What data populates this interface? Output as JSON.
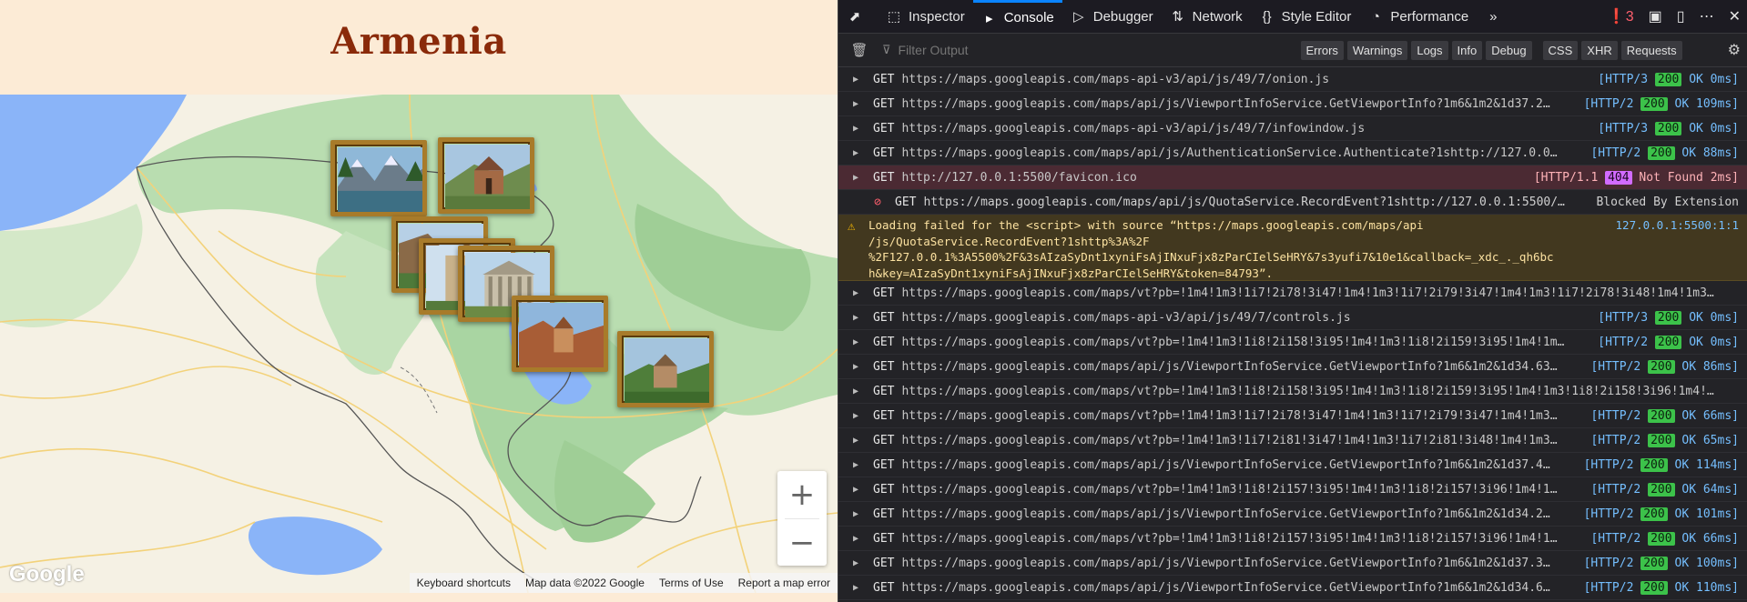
{
  "page": {
    "title": "Armenia",
    "map": {
      "zoom_in": "+",
      "zoom_out": "−",
      "logo": "Google",
      "footer": [
        "Keyboard shortcuts",
        "Map data ©2022 Google",
        "Terms of Use",
        "Report a map error"
      ]
    }
  },
  "devtools": {
    "tabs": [
      {
        "icon": "inspector-icon",
        "glyph": "⬚",
        "label": "Inspector"
      },
      {
        "icon": "console-icon",
        "glyph": "▸",
        "label": "Console",
        "active": true
      },
      {
        "icon": "debugger-icon",
        "glyph": "▷",
        "label": "Debugger"
      },
      {
        "icon": "network-icon",
        "glyph": "⇅",
        "label": "Network"
      },
      {
        "icon": "style-editor-icon",
        "glyph": "{}",
        "label": "Style Editor"
      },
      {
        "icon": "performance-icon",
        "glyph": "◔",
        "label": "Performance"
      }
    ],
    "error_count": "3",
    "filter_placeholder": "Filter Output",
    "filter_buttons": [
      "Errors",
      "Warnings",
      "Logs",
      "Info",
      "Debug",
      "CSS",
      "XHR",
      "Requests"
    ],
    "logs": [
      {
        "type": "net",
        "method": "GET",
        "url": "https://maps.googleapis.com/maps-api-v3/api/js/49/7/onion.js",
        "proto": "[HTTP/3",
        "code": "200",
        "tail": "OK 0ms]"
      },
      {
        "type": "net",
        "method": "GET",
        "url": "https://maps.googleapis.com/maps/api/js/ViewportInfoService.GetViewportInfo?1m6&1m2&1d37.2…",
        "proto": "[HTTP/2",
        "code": "200",
        "tail": "OK 109ms]"
      },
      {
        "type": "net",
        "method": "GET",
        "url": "https://maps.googleapis.com/maps-api-v3/api/js/49/7/infowindow.js",
        "proto": "[HTTP/3",
        "code": "200",
        "tail": "OK 0ms]"
      },
      {
        "type": "net",
        "method": "GET",
        "url": "https://maps.googleapis.com/maps/api/js/AuthenticationService.Authenticate?1shttp://127.0.0…",
        "proto": "[HTTP/2",
        "code": "200",
        "tail": "OK 88ms]"
      },
      {
        "type": "err",
        "method": "GET",
        "url": "http://127.0.0.1:5500/favicon.ico",
        "proto": "[HTTP/1.1",
        "code": "404",
        "tail": "Not Found 2ms]"
      },
      {
        "type": "block",
        "method": "GET",
        "url": "https://maps.googleapis.com/maps/api/js/QuotaService.RecordEvent?1shttp://127.0.0.1:5500/…",
        "proto": "",
        "code": "",
        "tail": "Blocked By Extension"
      },
      {
        "type": "warn",
        "text": "Loading failed for the <script> with source “https://maps.googleapis.com/maps/api\n/js/QuotaService.RecordEvent?1shttp%3A%2F\n%2F127.0.0.1%3A5500%2F&3sAIzaSyDnt1xyniFsAjINxuFjx8zParCIelSeHRY&7s3yufi7&10e1&callback=_xdc_._qh6bc\nh&key=AIzaSyDnt1xyniFsAjINxuFjx8zParCIelSeHRY&token=84793”.",
        "source": "127.0.0.1:5500:1:1"
      },
      {
        "type": "net",
        "method": "GET",
        "url": "https://maps.googleapis.com/maps/vt?pb=!1m4!1m3!1i7!2i78!3i47!1m4!1m3!1i7!2i79!3i47!1m4!1m3!1i7!2i78!3i48!1m4!1m3…",
        "proto": "",
        "code": "",
        "tail": ""
      },
      {
        "type": "net",
        "method": "GET",
        "url": "https://maps.googleapis.com/maps-api-v3/api/js/49/7/controls.js",
        "proto": "[HTTP/3",
        "code": "200",
        "tail": "OK 0ms]"
      },
      {
        "type": "net",
        "method": "GET",
        "url": "https://maps.googleapis.com/maps/vt?pb=!1m4!1m3!1i8!2i158!3i95!1m4!1m3!1i8!2i159!3i95!1m4!1m…",
        "proto": "[HTTP/2",
        "code": "200",
        "tail": "OK 0ms]"
      },
      {
        "type": "net",
        "method": "GET",
        "url": "https://maps.googleapis.com/maps/api/js/ViewportInfoService.GetViewportInfo?1m6&1m2&1d34.63…",
        "proto": "[HTTP/2",
        "code": "200",
        "tail": "OK 86ms]"
      },
      {
        "type": "net",
        "method": "GET",
        "url": "https://maps.googleapis.com/maps/vt?pb=!1m4!1m3!1i8!2i158!3i95!1m4!1m3!1i8!2i159!3i95!1m4!1m3!1i8!2i158!3i96!1m4!…",
        "proto": "",
        "code": "",
        "tail": ""
      },
      {
        "type": "net",
        "method": "GET",
        "url": "https://maps.googleapis.com/maps/vt?pb=!1m4!1m3!1i7!2i78!3i47!1m4!1m3!1i7!2i79!3i47!1m4!1m3…",
        "proto": "[HTTP/2",
        "code": "200",
        "tail": "OK 66ms]"
      },
      {
        "type": "net",
        "method": "GET",
        "url": "https://maps.googleapis.com/maps/vt?pb=!1m4!1m3!1i7!2i81!3i47!1m4!1m3!1i7!2i81!3i48!1m4!1m3…",
        "proto": "[HTTP/2",
        "code": "200",
        "tail": "OK 65ms]"
      },
      {
        "type": "net",
        "method": "GET",
        "url": "https://maps.googleapis.com/maps/api/js/ViewportInfoService.GetViewportInfo?1m6&1m2&1d37.4…",
        "proto": "[HTTP/2",
        "code": "200",
        "tail": "OK 114ms]"
      },
      {
        "type": "net",
        "method": "GET",
        "url": "https://maps.googleapis.com/maps/vt?pb=!1m4!1m3!1i8!2i157!3i95!1m4!1m3!1i8!2i157!3i96!1m4!1…",
        "proto": "[HTTP/2",
        "code": "200",
        "tail": "OK 64ms]"
      },
      {
        "type": "net",
        "method": "GET",
        "url": "https://maps.googleapis.com/maps/api/js/ViewportInfoService.GetViewportInfo?1m6&1m2&1d34.2…",
        "proto": "[HTTP/2",
        "code": "200",
        "tail": "OK 101ms]"
      },
      {
        "type": "net",
        "method": "GET",
        "url": "https://maps.googleapis.com/maps/vt?pb=!1m4!1m3!1i8!2i157!3i95!1m4!1m3!1i8!2i157!3i96!1m4!1…",
        "proto": "[HTTP/2",
        "code": "200",
        "tail": "OK 66ms]"
      },
      {
        "type": "net",
        "method": "GET",
        "url": "https://maps.googleapis.com/maps/api/js/ViewportInfoService.GetViewportInfo?1m6&1m2&1d37.3…",
        "proto": "[HTTP/2",
        "code": "200",
        "tail": "OK 100ms]"
      },
      {
        "type": "net",
        "method": "GET",
        "url": "https://maps.googleapis.com/maps/api/js/ViewportInfoService.GetViewportInfo?1m6&1m2&1d34.6…",
        "proto": "[HTTP/2",
        "code": "200",
        "tail": "OK 110ms]"
      }
    ]
  }
}
